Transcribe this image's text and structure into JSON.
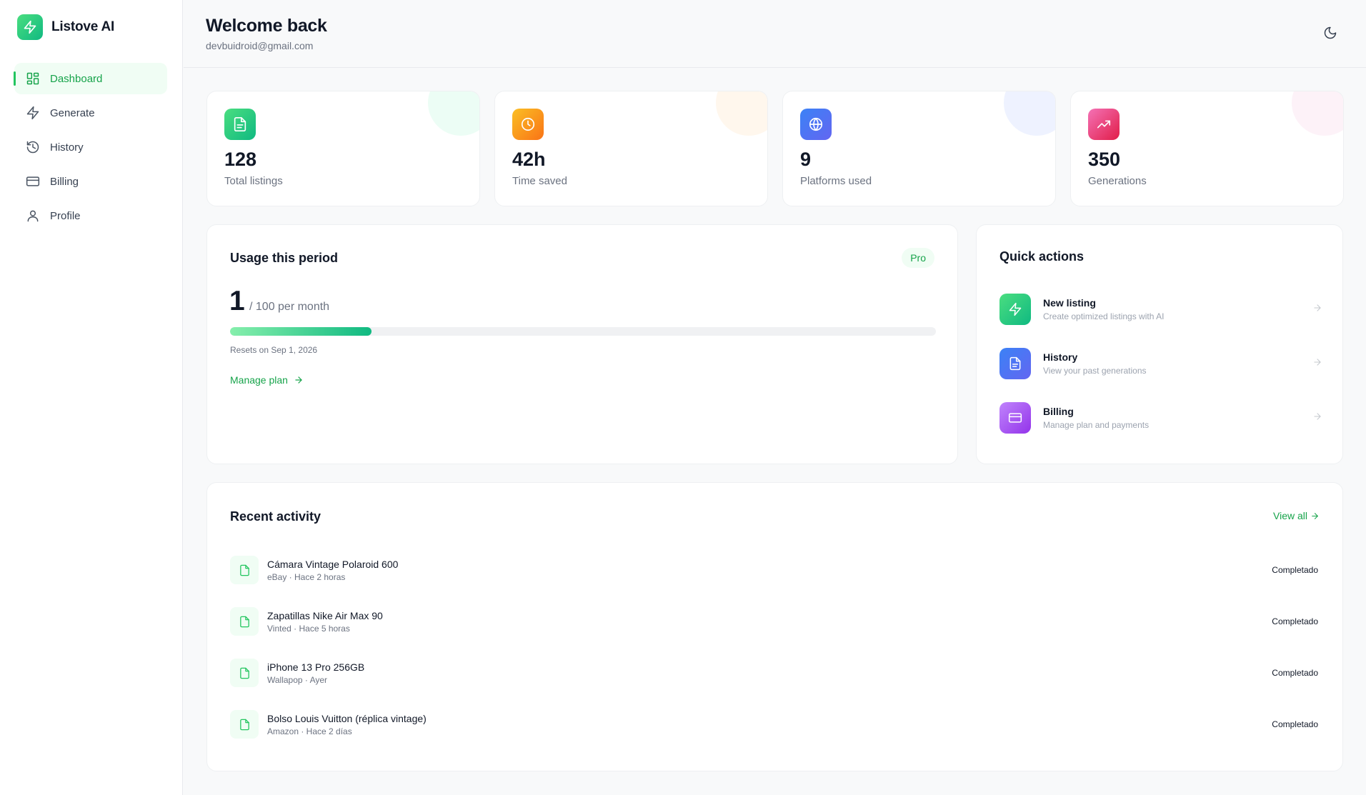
{
  "brand": {
    "name": "Listove AI"
  },
  "sidebar": {
    "items": [
      {
        "label": "Dashboard",
        "icon": "dashboard-icon"
      },
      {
        "label": "Generate",
        "icon": "zap-icon"
      },
      {
        "label": "History",
        "icon": "history-icon"
      },
      {
        "label": "Billing",
        "icon": "credit-card-icon"
      },
      {
        "label": "Profile",
        "icon": "user-icon"
      }
    ]
  },
  "header": {
    "title": "Welcome back",
    "email": "devbuidroid@gmail.com",
    "theme_icon": "moon-icon"
  },
  "stats": [
    {
      "value": "128",
      "label": "Total listings",
      "icon": "file-text-icon",
      "color": "#10b981"
    },
    {
      "value": "42h",
      "label": "Time saved",
      "icon": "clock-icon",
      "color": "#f97316"
    },
    {
      "value": "9",
      "label": "Platforms used",
      "icon": "globe-icon",
      "color": "#6366f1"
    },
    {
      "value": "350",
      "label": "Generations",
      "icon": "trending-up-icon",
      "color": "#ec4899"
    }
  ],
  "usage": {
    "title": "Usage this period",
    "plan_badge": "Pro",
    "used": "1",
    "limit_text": "/ 100 per month",
    "progress_fraction": 0.2,
    "resets_text": "Resets on Sep 1, 2026",
    "manage_label": "Manage plan"
  },
  "quick_actions": {
    "title": "Quick actions",
    "items": [
      {
        "title": "New listing",
        "description": "Create optimized listings with AI",
        "icon": "zap-icon",
        "color": "#22c55e"
      },
      {
        "title": "History",
        "description": "View your past generations",
        "icon": "file-text-icon",
        "color": "#6366f1"
      },
      {
        "title": "Billing",
        "description": "Manage plan and payments",
        "icon": "credit-card-icon",
        "color": "#a855f7"
      }
    ]
  },
  "recent": {
    "title": "Recent activity",
    "view_all_label": "View all",
    "items": [
      {
        "name": "Cámara Vintage Polaroid 600",
        "meta": "eBay · Hace 2 horas",
        "status": "Completado"
      },
      {
        "name": "Zapatillas Nike Air Max 90",
        "meta": "Vinted · Hace 5 horas",
        "status": "Completado"
      },
      {
        "name": "iPhone 13 Pro 256GB",
        "meta": "Wallapop · Ayer",
        "status": "Completado"
      },
      {
        "name": "Bolso Louis Vuitton (réplica vintage)",
        "meta": "Amazon · Hace 2 días",
        "status": "Completado"
      }
    ]
  },
  "colors": {
    "accent": "#16a34a",
    "accent_light": "#f0fdf4",
    "background": "#f8f9fa"
  }
}
